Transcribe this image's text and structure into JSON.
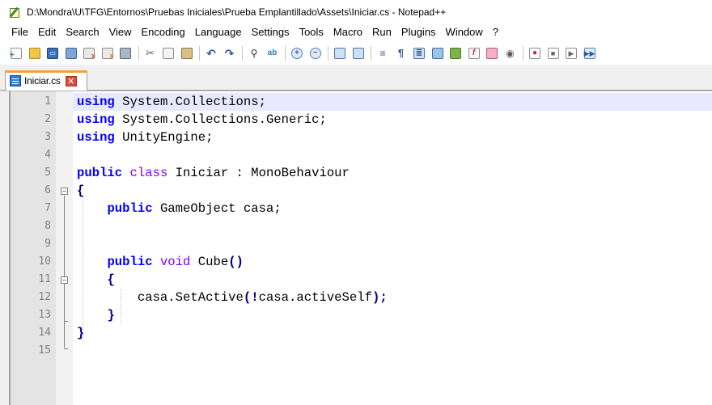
{
  "window": {
    "title": "D:\\Mondra\\U\\TFG\\Entornos\\Pruebas Iniciales\\Prueba Emplantillado\\Assets\\Iniciar.cs - Notepad++"
  },
  "menu": {
    "items": [
      "File",
      "Edit",
      "Search",
      "View",
      "Encoding",
      "Language",
      "Settings",
      "Tools",
      "Macro",
      "Run",
      "Plugins",
      "Window",
      "?"
    ]
  },
  "toolbar": {
    "icons": [
      "new-file-icon",
      "open-file-icon",
      "save-icon",
      "save-all-icon",
      "close-icon",
      "close-all-icon",
      "print-icon",
      "cut-icon",
      "copy-icon",
      "paste-icon",
      "undo-icon",
      "redo-icon",
      "find-icon",
      "replace-icon",
      "zoom-in-icon",
      "zoom-out-icon",
      "sync-vertical-icon",
      "sync-horizontal-icon",
      "word-wrap-icon",
      "show-all-chars-icon",
      "indent-guide-icon",
      "user-language-icon",
      "doc-map-icon",
      "function-list-icon",
      "folder-workspace-icon",
      "monitoring-icon",
      "record-macro-icon",
      "stop-macro-icon",
      "play-macro-icon",
      "run-macro-multiple-icon"
    ]
  },
  "tabs": [
    {
      "label": "Iniciar.cs",
      "active": true
    }
  ],
  "editor": {
    "current_line": 1,
    "line_numbers": [
      "1",
      "2",
      "3",
      "4",
      "5",
      "6",
      "7",
      "8",
      "9",
      "10",
      "11",
      "12",
      "13",
      "14",
      "15"
    ],
    "lines": [
      [
        {
          "t": "using",
          "c": "kw"
        },
        {
          "t": " System.Collections;",
          "c": ""
        }
      ],
      [
        {
          "t": "using",
          "c": "kw"
        },
        {
          "t": " System.Collections.Generic;",
          "c": ""
        }
      ],
      [
        {
          "t": "using",
          "c": "kw"
        },
        {
          "t": " UnityEngine;",
          "c": ""
        }
      ],
      [],
      [
        {
          "t": "public",
          "c": "kw"
        },
        {
          "t": " ",
          "c": ""
        },
        {
          "t": "class",
          "c": "kw2"
        },
        {
          "t": " Iniciar : MonoBehaviour",
          "c": ""
        }
      ],
      [
        {
          "t": "{",
          "c": "op"
        }
      ],
      [
        {
          "t": "    ",
          "c": ""
        },
        {
          "t": "public",
          "c": "kw"
        },
        {
          "t": " GameObject casa;",
          "c": ""
        }
      ],
      [],
      [],
      [
        {
          "t": "    ",
          "c": ""
        },
        {
          "t": "public",
          "c": "kw"
        },
        {
          "t": " ",
          "c": ""
        },
        {
          "t": "void",
          "c": "kw2"
        },
        {
          "t": " Cube",
          "c": ""
        },
        {
          "t": "()",
          "c": "op"
        }
      ],
      [
        {
          "t": "    ",
          "c": ""
        },
        {
          "t": "{",
          "c": "op"
        }
      ],
      [
        {
          "t": "        casa.SetActive",
          "c": ""
        },
        {
          "t": "(!",
          "c": "op"
        },
        {
          "t": "casa.activeSelf",
          "c": ""
        },
        {
          "t": ");",
          "c": "op"
        }
      ],
      [
        {
          "t": "    ",
          "c": ""
        },
        {
          "t": "}",
          "c": "op"
        }
      ],
      [
        {
          "t": "}",
          "c": "op"
        }
      ],
      []
    ]
  },
  "colors": {
    "keyword": "#0000ff",
    "type_keyword": "#8000ff",
    "operator": "#000080",
    "current_line_bg": "#e8e8ff",
    "tab_accent": "#f8a040"
  }
}
